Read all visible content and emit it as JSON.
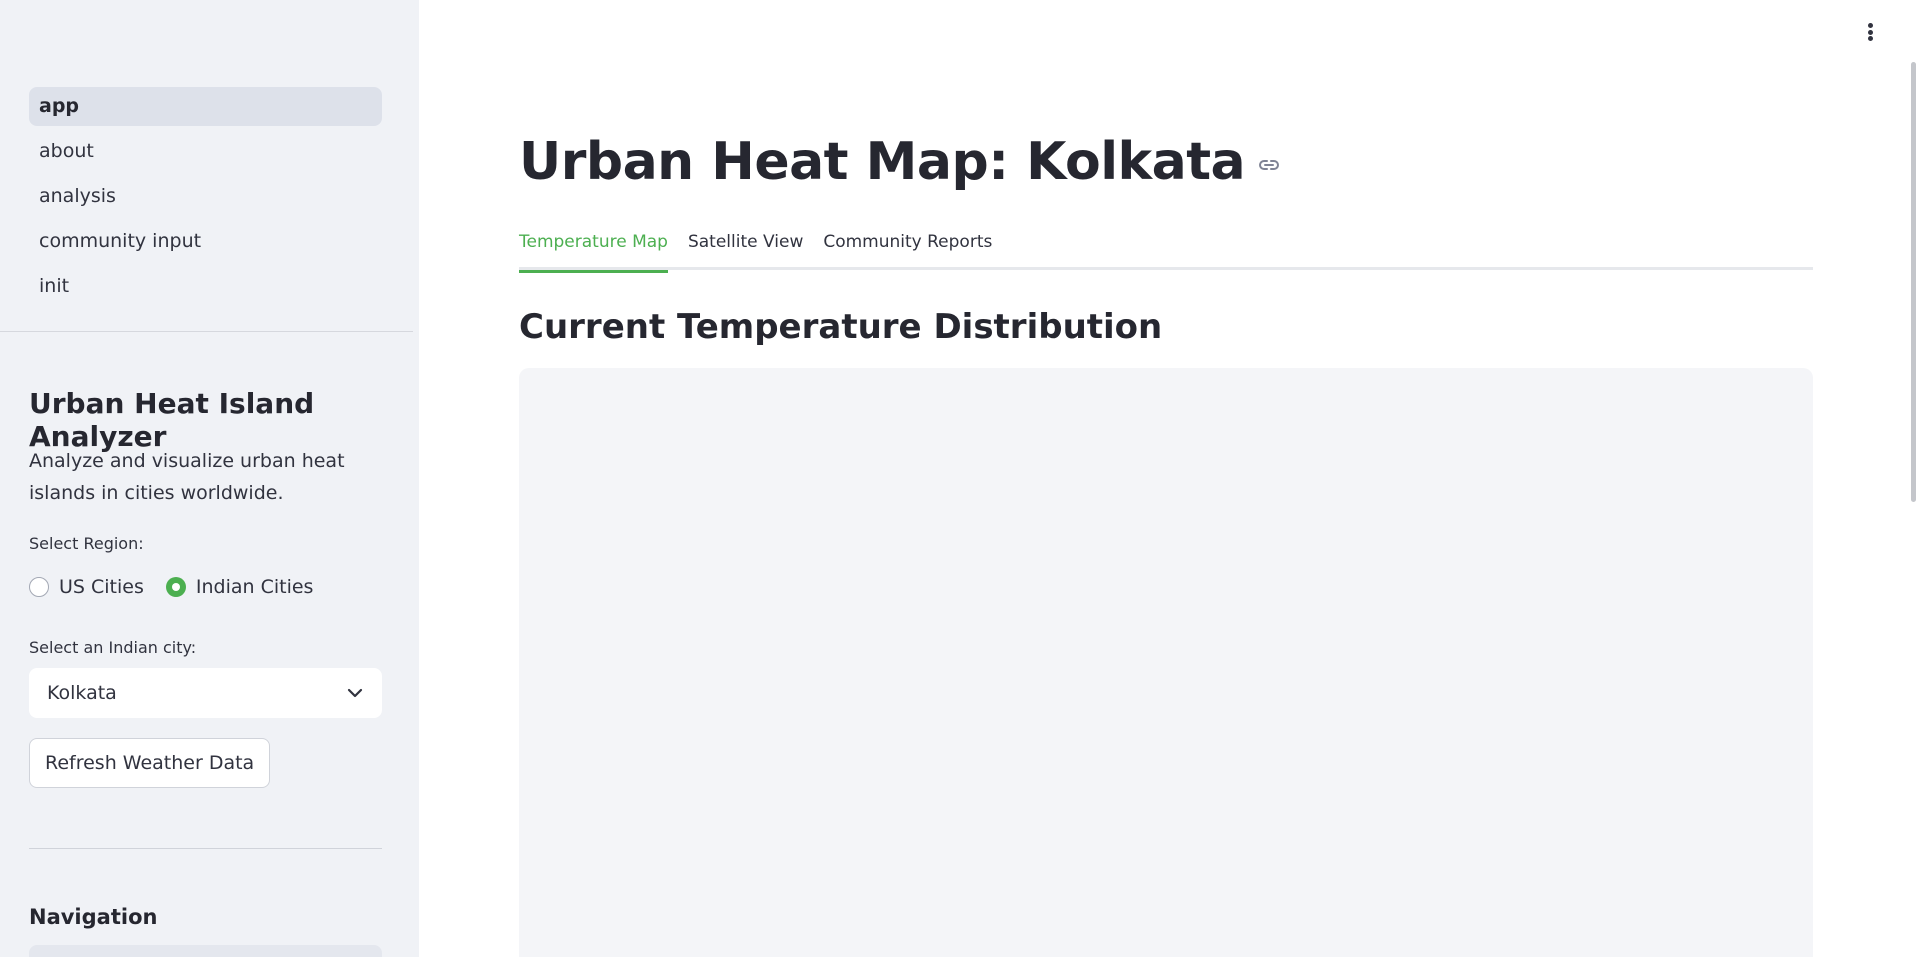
{
  "sidebar": {
    "pages": [
      {
        "label": "app",
        "active": true
      },
      {
        "label": "about",
        "active": false
      },
      {
        "label": "analysis",
        "active": false
      },
      {
        "label": "community input",
        "active": false
      },
      {
        "label": "init",
        "active": false
      }
    ],
    "title": "Urban Heat Island Analyzer",
    "description": "Analyze and visualize urban heat islands in cities worldwide.",
    "region_label": "Select Region:",
    "region_options": [
      {
        "label": "US Cities",
        "checked": false
      },
      {
        "label": "Indian Cities",
        "checked": true
      }
    ],
    "city_label": "Select an Indian city:",
    "city_selected": "Kolkata",
    "refresh_button": "Refresh Weather Data",
    "navigation_heading": "Navigation"
  },
  "main": {
    "title": "Urban Heat Map: Kolkata",
    "tabs": [
      {
        "label": "Temperature Map",
        "active": true
      },
      {
        "label": "Satellite View",
        "active": false
      },
      {
        "label": "Community Reports",
        "active": false
      }
    ],
    "section_title": "Current Temperature Distribution"
  },
  "colors": {
    "accent": "#4caf50",
    "sidebar_bg": "#f0f2f6",
    "text": "#31333f"
  },
  "icons": {
    "menu": "kebab-menu-icon",
    "anchor": "link-icon",
    "select": "chevron-down-icon"
  }
}
